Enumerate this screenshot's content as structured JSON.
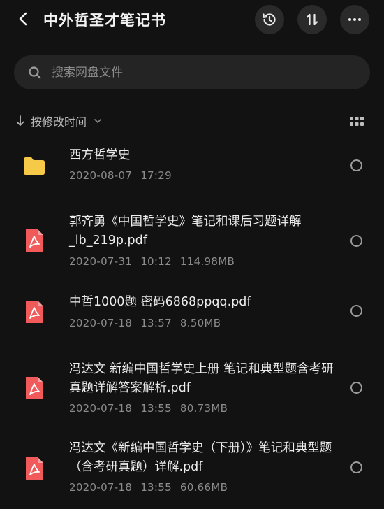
{
  "header": {
    "title": "中外哲圣才笔记书"
  },
  "search": {
    "placeholder": "搜索网盘文件"
  },
  "sort": {
    "label": "按修改时间"
  },
  "files": [
    {
      "type": "folder",
      "name": "西方哲学史",
      "date": "2020-08-07",
      "time": "17:29",
      "size": ""
    },
    {
      "type": "pdf",
      "name": "郭齐勇《中国哲学史》笔记和课后习题详解_lb_219p.pdf",
      "date": "2020-07-31",
      "time": "10:12",
      "size": "114.98MB"
    },
    {
      "type": "pdf",
      "name": "中哲1000题 密码6868ppqq.pdf",
      "date": "2020-07-18",
      "time": "13:57",
      "size": "8.50MB"
    },
    {
      "type": "pdf",
      "name": "冯达文 新编中国哲学史上册 笔记和典型题含考研真题详解答案解析.pdf",
      "date": "2020-07-18",
      "time": "13:55",
      "size": "80.73MB"
    },
    {
      "type": "pdf",
      "name": "冯达文《新编中国哲学史（下册）》笔记和典型题（含考研真题）详解.pdf",
      "date": "2020-07-18",
      "time": "13:55",
      "size": "60.66MB"
    }
  ],
  "colors": {
    "background": "#121212",
    "folder": "#f7c948",
    "pdf": "#f05a5a",
    "button_bg": "#2a2a2a",
    "search_bg": "#242424"
  },
  "icons": {
    "back": "chevron-left-icon",
    "history": "history-icon",
    "sort": "sort-arrows-icon",
    "more": "more-dots-icon",
    "search": "search-icon",
    "sort_direction": "arrow-down-icon",
    "grid": "grid-view-icon",
    "folder": "folder-icon",
    "pdf": "pdf-icon"
  }
}
